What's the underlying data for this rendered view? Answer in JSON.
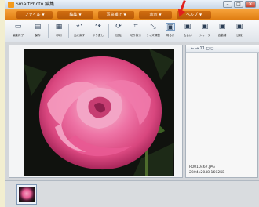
{
  "window": {
    "title": "SmartPhoto 編集",
    "minimize": "–",
    "maximize": "□",
    "close": "✕"
  },
  "menus": [
    {
      "label": "ファイル"
    },
    {
      "label": "編集"
    },
    {
      "label": "写真補正"
    },
    {
      "label": "表示"
    },
    {
      "label": "ヘルプ"
    }
  ],
  "toolbar": [
    {
      "icon": "edit-end-icon",
      "glyph": "▭",
      "label": "編集終了"
    },
    {
      "icon": "save-icon",
      "glyph": "▤",
      "label": "保存"
    },
    {
      "icon": "print-icon",
      "glyph": "▦",
      "label": "印刷"
    },
    {
      "icon": "undo-icon",
      "glyph": "↶",
      "label": "元に戻す"
    },
    {
      "icon": "redo-icon",
      "glyph": "↷",
      "label": "やり直し"
    },
    {
      "icon": "rotate-icon",
      "glyph": "⟳",
      "label": "回転"
    },
    {
      "icon": "crop-icon",
      "glyph": "⌗",
      "label": "切り抜き"
    },
    {
      "icon": "resize-icon",
      "glyph": "⤡",
      "label": "サイズ調整"
    },
    {
      "icon": "brightness-icon",
      "glyph": "▣",
      "label": "明るさ"
    },
    {
      "icon": "color-icon",
      "glyph": "▣",
      "label": "色合い"
    },
    {
      "icon": "sharpness-icon",
      "glyph": "▣",
      "label": "シャープ"
    },
    {
      "icon": "auto-icon",
      "glyph": "▣",
      "label": "自動補"
    },
    {
      "icon": "compare-icon",
      "glyph": "▣",
      "label": "比較"
    }
  ],
  "panel": {
    "nav_text": "←  →  11  ◻  ◻",
    "filename": "R0010467.JPG",
    "filesize": "2304x2048 1602KB"
  }
}
